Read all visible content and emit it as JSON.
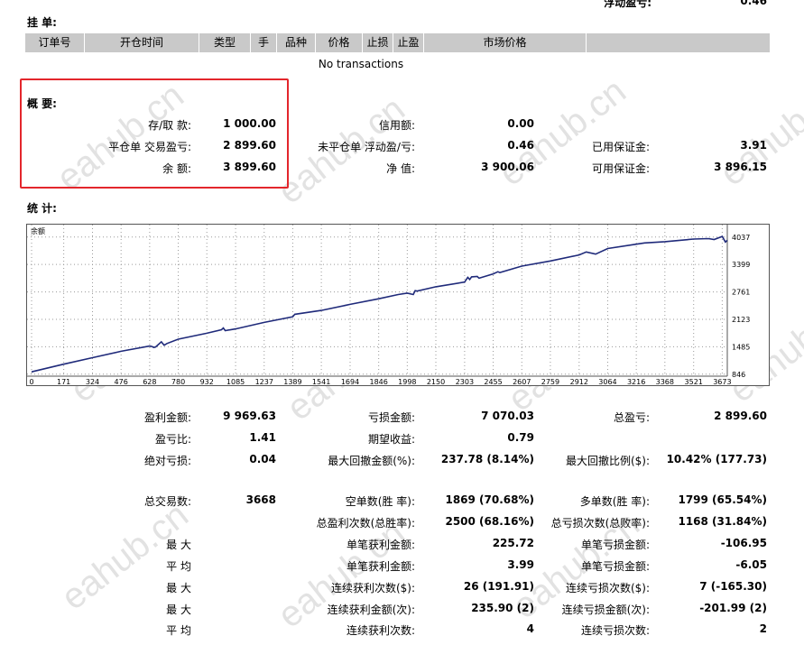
{
  "top_partial": {
    "label": "浮动盈亏:",
    "value": "0.46"
  },
  "pending": {
    "title": "挂 单:",
    "columns": [
      "订单号",
      "开仓时间",
      "类型",
      "手",
      "品种",
      "价格",
      "止损",
      "止盈",
      "市场价格",
      ""
    ],
    "empty_text": "No transactions"
  },
  "summary": {
    "title": "概 要:",
    "rows": [
      [
        {
          "label": "存/取 款:",
          "value": "1 000.00"
        },
        {
          "label": "信用额:",
          "value": "0.00"
        },
        {
          "label": "",
          "value": ""
        }
      ],
      [
        {
          "label": "平仓单 交易盈亏:",
          "value": "2 899.60"
        },
        {
          "label": "未平仓单 浮动盈/亏:",
          "value": "0.46"
        },
        {
          "label": "已用保证金:",
          "value": "3.91"
        }
      ],
      [
        {
          "label": "余 额:",
          "value": "3 899.60"
        },
        {
          "label": "净 值:",
          "value": "3 900.06"
        },
        {
          "label": "可用保证金:",
          "value": "3 896.15"
        }
      ]
    ]
  },
  "stats": {
    "title": "统 计:",
    "rows": [
      [
        "盈利金额:",
        "9 969.63",
        "亏损金额:",
        "7 070.03",
        "总盈亏:",
        "2 899.60"
      ],
      [
        "盈亏比:",
        "1.41",
        "期望收益:",
        "0.79",
        "",
        ""
      ],
      [
        "绝对亏损:",
        "0.04",
        "最大回撤金额(%):",
        "237.78 (8.14%)",
        "最大回撤比例($):",
        "10.42% (177.73)"
      ],
      [
        "总交易数:",
        "3668",
        "空单数(胜 率):",
        "1869 (70.68%)",
        "多单数(胜 率):",
        "1799 (65.54%)"
      ],
      [
        "",
        "",
        "总盈利次数(总胜率):",
        "2500 (68.16%)",
        "总亏损次数(总败率):",
        "1168 (31.84%)"
      ],
      [
        "最 大",
        "",
        "单笔获利金额:",
        "225.72",
        "单笔亏损金额:",
        "-106.95"
      ],
      [
        "平 均",
        "",
        "单笔获利金额:",
        "3.99",
        "单笔亏损金额:",
        "-6.05"
      ],
      [
        "最 大",
        "",
        "连续获利次数($):",
        "26 (191.91)",
        "连续亏损次数($):",
        "7 (-165.30)"
      ],
      [
        "最 大",
        "",
        "连续获利金额(次):",
        "235.90 (2)",
        "连续亏损金额(次):",
        "-201.99 (2)"
      ],
      [
        "平 均",
        "",
        "连续获利次数:",
        "4",
        "连续亏损次数:",
        "2"
      ]
    ]
  },
  "watermark": "eahub.cn",
  "chart_data": {
    "type": "line",
    "title": "余额",
    "x_ticks": [
      0,
      171,
      324,
      476,
      628,
      780,
      932,
      1085,
      1237,
      1389,
      1541,
      1694,
      1846,
      1998,
      2150,
      2303,
      2455,
      2607,
      2759,
      2912,
      3064,
      3216,
      3368,
      3521,
      3673
    ],
    "y_ticks": [
      846,
      1485,
      2123,
      2761,
      3399,
      4037
    ],
    "xlim": [
      0,
      3700
    ],
    "ylim": [
      800,
      4200
    ],
    "line_color": "#1f2a7a",
    "series": [
      {
        "x": [
          0,
          171,
          324,
          476,
          628,
          640,
          650,
          660,
          690,
          705,
          720,
          780,
          932,
          1010,
          1020,
          1030,
          1085,
          1237,
          1389,
          1400,
          1541,
          1694,
          1846,
          1950,
          1998,
          2030,
          2040,
          2050,
          2150,
          2303,
          2320,
          2330,
          2340,
          2370,
          2380,
          2455,
          2480,
          2490,
          2607,
          2759,
          2912,
          2950,
          3000,
          3064,
          3216,
          3260,
          3368,
          3521,
          3600,
          3630,
          3673,
          3690,
          3700
        ],
        "y": [
          900,
          1080,
          1230,
          1380,
          1500,
          1490,
          1470,
          1480,
          1600,
          1520,
          1560,
          1660,
          1800,
          1880,
          1920,
          1860,
          1900,
          2050,
          2180,
          2240,
          2330,
          2470,
          2600,
          2700,
          2730,
          2700,
          2790,
          2780,
          2880,
          2990,
          3100,
          3050,
          3110,
          3120,
          3080,
          3180,
          3230,
          3210,
          3360,
          3480,
          3620,
          3690,
          3640,
          3770,
          3870,
          3900,
          3930,
          3990,
          4000,
          3980,
          4050,
          3920,
          3960
        ]
      }
    ]
  }
}
